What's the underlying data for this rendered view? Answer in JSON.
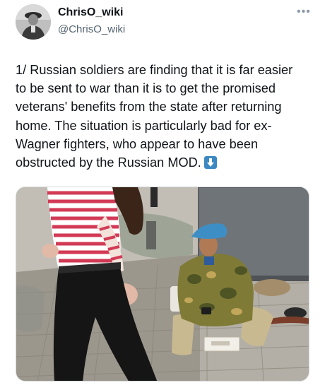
{
  "author": {
    "display_name": "ChrisO_wiki",
    "handle": "@ChrisO_wiki",
    "avatar_icon": "user-avatar-soldier-photo"
  },
  "more_icon": "more-horizontal-icon",
  "tweet": {
    "lines": [
      "1/ Russian soldiers are finding that it is far easier",
      "to be sent to war than it is to get the promised",
      "veterans' benefits from the state after returning",
      "home. The situation is particularly bad for ex-",
      "Wagner fighters, who appear to have been",
      "obstructed by the Russian MOD."
    ],
    "trailing_emoji": "down-arrow-emoji-icon"
  },
  "media": {
    "kind": "photo",
    "accent_colors": {
      "beret": "#3d8ec4",
      "camouflage": "#8a8a3a",
      "striped_top": "#d23a55",
      "pavement": "#9a958b"
    }
  }
}
